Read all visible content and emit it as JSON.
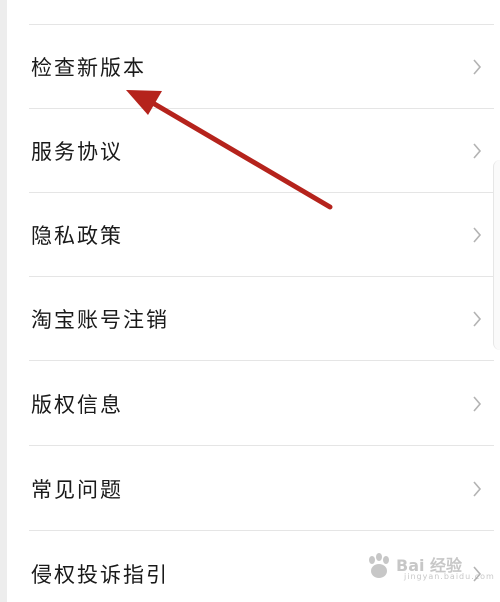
{
  "settings_menu": {
    "items": [
      {
        "label": "检查新版本"
      },
      {
        "label": "服务协议"
      },
      {
        "label": "隐私政策"
      },
      {
        "label": "淘宝账号注销"
      },
      {
        "label": "版权信息"
      },
      {
        "label": "常见问题"
      },
      {
        "label": "侵权投诉指引"
      }
    ],
    "chevron_icon": "chevron-right-icon"
  },
  "annotation": {
    "arrow_color": "#b5231c",
    "arrow_icon": "annotation-arrow-icon"
  },
  "watermark": {
    "brand_text": "Bai 经验",
    "sub_text": "jingyan.baidu.com"
  }
}
